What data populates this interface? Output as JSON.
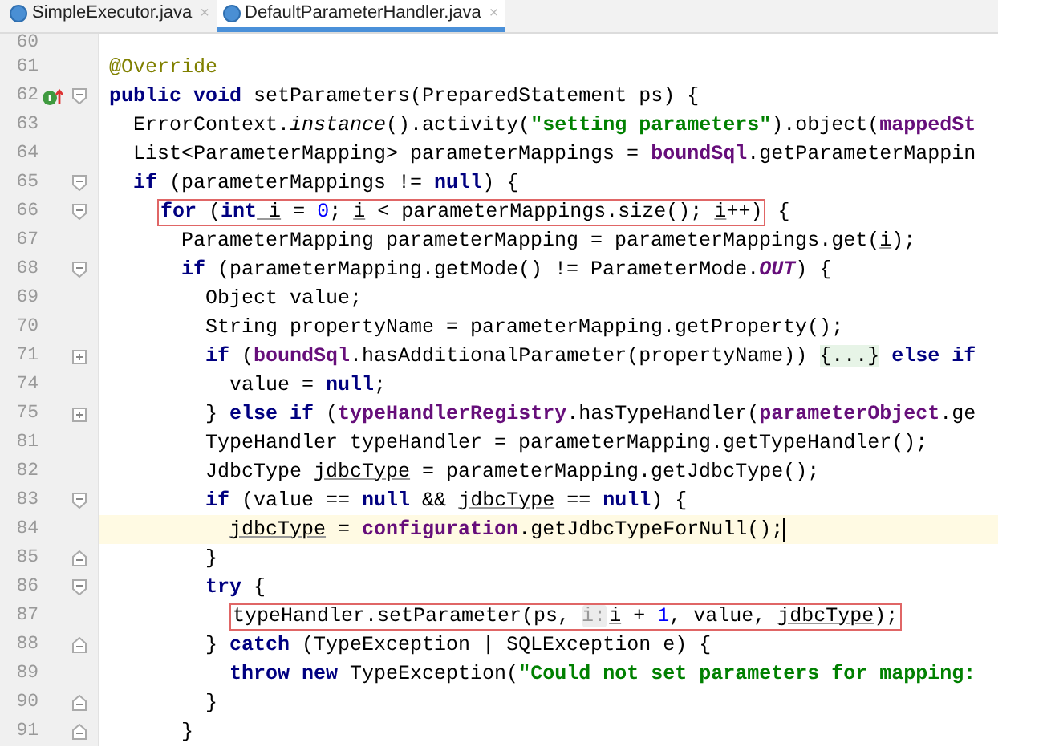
{
  "tabs": [
    {
      "label": "SimpleExecutor.java",
      "close": "×",
      "selected": false
    },
    {
      "label": "DefaultParameterHandler.java",
      "close": "×",
      "selected": true
    }
  ],
  "lines": [
    {
      "number": "60",
      "kind": "statement",
      "overrides": false,
      "current": false,
      "caret": false
    },
    {
      "number": "61",
      "kind": "statement",
      "overrides": false,
      "current": false,
      "caret": false,
      "segments": [
        {
          "kind": "text",
          "tokens": [
            {
              "text": "@Override",
              "kind": "annotation"
            }
          ]
        }
      ]
    },
    {
      "number": "62",
      "kind": "block_start",
      "overrides": true,
      "current": false,
      "caret": false,
      "segments": [
        {
          "kind": "text",
          "tokens": [
            {
              "text": "public",
              "kind": "keyword"
            },
            {
              "text": " void",
              "kind": "keyword"
            },
            {
              "text": " setParameters(PreparedStatement ps) {",
              "kind": "plain"
            }
          ]
        }
      ],
      "children": [
        {
          "number": "63",
          "kind": "statement",
          "overrides": false,
          "current": false,
          "caret": false,
          "segments": [
            {
              "kind": "text",
              "tokens": [
                {
                  "text": "ErrorContext.",
                  "kind": "plain"
                },
                {
                  "text": "instance",
                  "kind": "static_method"
                },
                {
                  "text": "().activity(",
                  "kind": "plain"
                },
                {
                  "text": "\"setting parameters\"",
                  "kind": "string"
                },
                {
                  "text": ").object(",
                  "kind": "plain"
                },
                {
                  "text": "mappedSt",
                  "kind": "field"
                }
              ]
            }
          ]
        },
        {
          "number": "64",
          "kind": "statement",
          "overrides": false,
          "current": false,
          "caret": false,
          "segments": [
            {
              "kind": "text",
              "tokens": [
                {
                  "text": "List<ParameterMapping> parameterMappings = ",
                  "kind": "plain"
                },
                {
                  "text": "boundSql",
                  "kind": "field"
                },
                {
                  "text": ".getParameterMappin",
                  "kind": "plain"
                }
              ]
            }
          ]
        },
        {
          "number": "65",
          "kind": "block_start",
          "overrides": false,
          "current": false,
          "caret": false,
          "segments": [
            {
              "kind": "text",
              "tokens": [
                {
                  "text": "if",
                  "kind": "keyword"
                },
                {
                  "text": " (parameterMappings != ",
                  "kind": "plain"
                },
                {
                  "text": "null",
                  "kind": "keyword"
                },
                {
                  "text": ") {",
                  "kind": "plain"
                }
              ]
            }
          ],
          "children": [
            {
              "number": "66",
              "kind": "block_start",
              "overrides": false,
              "current": false,
              "caret": false,
              "segments": [
                {
                  "kind": "box",
                  "tokens": [
                    {
                      "text": "for",
                      "kind": "keyword"
                    },
                    {
                      "text": " (",
                      "kind": "plain"
                    },
                    {
                      "text": "int",
                      "kind": "keyword"
                    },
                    {
                      "text": " i",
                      "kind": "variable"
                    },
                    {
                      "text": " = ",
                      "kind": "plain"
                    },
                    {
                      "text": "0",
                      "kind": "number"
                    },
                    {
                      "text": "; ",
                      "kind": "plain"
                    },
                    {
                      "text": "i",
                      "kind": "variable"
                    },
                    {
                      "text": " < parameterMappings.size(); ",
                      "kind": "plain"
                    },
                    {
                      "text": "i",
                      "kind": "variable"
                    },
                    {
                      "text": "++)",
                      "kind": "plain"
                    }
                  ]
                },
                {
                  "kind": "text",
                  "tokens": [
                    {
                      "text": " {",
                      "kind": "plain"
                    }
                  ]
                }
              ],
              "children": [
                {
                  "number": "67",
                  "kind": "statement",
                  "overrides": false,
                  "current": false,
                  "caret": false,
                  "segments": [
                    {
                      "kind": "text",
                      "tokens": [
                        {
                          "text": "ParameterMapping parameterMapping = parameterMappings.get(",
                          "kind": "plain"
                        },
                        {
                          "text": "i",
                          "kind": "variable"
                        },
                        {
                          "text": ");",
                          "kind": "plain"
                        }
                      ]
                    }
                  ]
                },
                {
                  "number": "68",
                  "kind": "block_start",
                  "overrides": false,
                  "current": false,
                  "caret": false,
                  "segments": [
                    {
                      "kind": "text",
                      "tokens": [
                        {
                          "text": "if",
                          "kind": "keyword"
                        },
                        {
                          "text": " (parameterMapping.getMode() != ParameterMode.",
                          "kind": "plain"
                        },
                        {
                          "text": "OUT",
                          "kind": "constant"
                        },
                        {
                          "text": ") {",
                          "kind": "plain"
                        }
                      ]
                    }
                  ],
                  "children": [
                    {
                      "number": "69",
                      "kind": "statement",
                      "overrides": false,
                      "current": false,
                      "caret": false,
                      "segments": [
                        {
                          "kind": "text",
                          "tokens": [
                            {
                              "text": "Object value;",
                              "kind": "plain"
                            }
                          ]
                        }
                      ]
                    },
                    {
                      "number": "70",
                      "kind": "statement",
                      "overrides": false,
                      "current": false,
                      "caret": false,
                      "segments": [
                        {
                          "kind": "text",
                          "tokens": [
                            {
                              "text": "String propertyName = parameterMapping.getProperty();",
                              "kind": "plain"
                            }
                          ]
                        }
                      ]
                    },
                    {
                      "number": "71",
                      "kind": "collapsed_block",
                      "overrides": false,
                      "current": false,
                      "caret": false,
                      "segments": [
                        {
                          "kind": "text",
                          "tokens": [
                            {
                              "text": "if",
                              "kind": "keyword"
                            },
                            {
                              "text": " (",
                              "kind": "plain"
                            },
                            {
                              "text": "boundSql",
                              "kind": "field"
                            },
                            {
                              "text": ".hasAdditionalParameter(propertyName)) ",
                              "kind": "plain"
                            },
                            {
                              "text": "{...}",
                              "kind": "folded"
                            },
                            {
                              "text": " else if",
                              "kind": "keyword"
                            }
                          ]
                        }
                      ],
                      "children": [
                        {
                          "number": "74",
                          "kind": "statement",
                          "overrides": false,
                          "current": false,
                          "caret": false,
                          "segments": [
                            {
                              "kind": "text",
                              "tokens": [
                                {
                                  "text": "value = ",
                                  "kind": "plain"
                                },
                                {
                                  "text": "null",
                                  "kind": "keyword"
                                },
                                {
                                  "text": ";",
                                  "kind": "plain"
                                }
                              ]
                            }
                          ]
                        }
                      ]
                    },
                    {
                      "number": "75",
                      "kind": "collapsed_block",
                      "overrides": false,
                      "current": false,
                      "caret": false,
                      "segments": [
                        {
                          "kind": "text",
                          "tokens": [
                            {
                              "text": "} ",
                              "kind": "plain"
                            },
                            {
                              "text": "else if",
                              "kind": "keyword"
                            },
                            {
                              "text": " (",
                              "kind": "plain"
                            },
                            {
                              "text": "typeHandlerRegistry",
                              "kind": "field"
                            },
                            {
                              "text": ".hasTypeHandler(",
                              "kind": "plain"
                            },
                            {
                              "text": "parameterObject",
                              "kind": "field"
                            },
                            {
                              "text": ".ge",
                              "kind": "plain"
                            }
                          ]
                        }
                      ]
                    },
                    {
                      "number": "81",
                      "kind": "statement",
                      "overrides": false,
                      "current": false,
                      "caret": false,
                      "segments": [
                        {
                          "kind": "text",
                          "tokens": [
                            {
                              "text": "TypeHandler typeHandler = parameterMapping.getTypeHandler();",
                              "kind": "plain"
                            }
                          ]
                        }
                      ]
                    },
                    {
                      "number": "82",
                      "kind": "statement",
                      "overrides": false,
                      "current": false,
                      "caret": false,
                      "segments": [
                        {
                          "kind": "text",
                          "tokens": [
                            {
                              "text": "JdbcType ",
                              "kind": "plain"
                            },
                            {
                              "text": "jdbcType",
                              "kind": "variable"
                            },
                            {
                              "text": " = parameterMapping.getJdbcType();",
                              "kind": "plain"
                            }
                          ]
                        }
                      ]
                    },
                    {
                      "number": "83",
                      "kind": "block_start",
                      "overrides": false,
                      "current": false,
                      "caret": false,
                      "segments": [
                        {
                          "kind": "text",
                          "tokens": [
                            {
                              "text": "if",
                              "kind": "keyword"
                            },
                            {
                              "text": " (value == ",
                              "kind": "plain"
                            },
                            {
                              "text": "null",
                              "kind": "keyword"
                            },
                            {
                              "text": " && ",
                              "kind": "plain"
                            },
                            {
                              "text": "jdbcType",
                              "kind": "variable"
                            },
                            {
                              "text": " == ",
                              "kind": "plain"
                            },
                            {
                              "text": "null",
                              "kind": "keyword"
                            },
                            {
                              "text": ") {",
                              "kind": "plain"
                            }
                          ]
                        }
                      ],
                      "children": [
                        {
                          "number": "84",
                          "kind": "statement",
                          "overrides": false,
                          "current": true,
                          "caret": true,
                          "segments": [
                            {
                              "kind": "text",
                              "tokens": [
                                {
                                  "text": "jdbcType",
                                  "kind": "variable"
                                },
                                {
                                  "text": " = ",
                                  "kind": "plain"
                                },
                                {
                                  "text": "configuration",
                                  "kind": "field"
                                },
                                {
                                  "text": ".getJdbcTypeForNull();",
                                  "kind": "plain"
                                }
                              ]
                            }
                          ]
                        }
                      ]
                    },
                    {
                      "number": "85",
                      "kind": "block_end",
                      "overrides": false,
                      "current": false,
                      "caret": false,
                      "segments": [
                        {
                          "kind": "text",
                          "tokens": [
                            {
                              "text": "}",
                              "kind": "plain"
                            }
                          ]
                        }
                      ]
                    },
                    {
                      "number": "86",
                      "kind": "block_start",
                      "overrides": false,
                      "current": false,
                      "caret": false,
                      "segments": [
                        {
                          "kind": "text",
                          "tokens": [
                            {
                              "text": "try",
                              "kind": "keyword"
                            },
                            {
                              "text": " {",
                              "kind": "plain"
                            }
                          ]
                        }
                      ],
                      "children": [
                        {
                          "number": "87",
                          "kind": "statement",
                          "overrides": false,
                          "current": false,
                          "caret": false,
                          "segments": [
                            {
                              "kind": "box",
                              "tokens": [
                                {
                                  "text": "typeHandler.setParameter(ps, ",
                                  "kind": "plain"
                                },
                                {
                                  "text": "i:",
                                  "kind": "hint"
                                },
                                {
                                  "text": "i",
                                  "kind": "variable"
                                },
                                {
                                  "text": " + ",
                                  "kind": "plain"
                                },
                                {
                                  "text": "1",
                                  "kind": "number"
                                },
                                {
                                  "text": ", value, ",
                                  "kind": "plain"
                                },
                                {
                                  "text": "jdbcType",
                                  "kind": "variable"
                                },
                                {
                                  "text": ");",
                                  "kind": "plain"
                                }
                              ]
                            }
                          ]
                        }
                      ]
                    },
                    {
                      "number": "88",
                      "kind": "block_end",
                      "overrides": false,
                      "current": false,
                      "caret": false,
                      "segments": [
                        {
                          "kind": "text",
                          "tokens": [
                            {
                              "text": "} ",
                              "kind": "plain"
                            },
                            {
                              "text": "catch",
                              "kind": "keyword"
                            },
                            {
                              "text": " (TypeException | SQLException e) {",
                              "kind": "plain"
                            }
                          ]
                        }
                      ],
                      "children": [
                        {
                          "number": "89",
                          "kind": "statement",
                          "overrides": false,
                          "current": false,
                          "caret": false,
                          "segments": [
                            {
                              "kind": "text",
                              "tokens": [
                                {
                                  "text": "throw",
                                  "kind": "keyword"
                                },
                                {
                                  "text": " new",
                                  "kind": "keyword"
                                },
                                {
                                  "text": " TypeException(",
                                  "kind": "plain"
                                },
                                {
                                  "text": "\"Could not set parameters for mapping:",
                                  "kind": "string"
                                }
                              ]
                            }
                          ]
                        }
                      ]
                    },
                    {
                      "number": "90",
                      "kind": "block_end",
                      "overrides": false,
                      "current": false,
                      "caret": false,
                      "segments": [
                        {
                          "kind": "text",
                          "tokens": [
                            {
                              "text": "}",
                              "kind": "plain"
                            }
                          ]
                        }
                      ]
                    }
                  ]
                },
                {
                  "number": "91",
                  "kind": "block_end",
                  "overrides": false,
                  "current": false,
                  "caret": false,
                  "segments": [
                    {
                      "kind": "text",
                      "tokens": [
                        {
                          "text": "}",
                          "kind": "plain"
                        }
                      ]
                    }
                  ]
                }
              ]
            }
          ]
        }
      ]
    }
  ]
}
